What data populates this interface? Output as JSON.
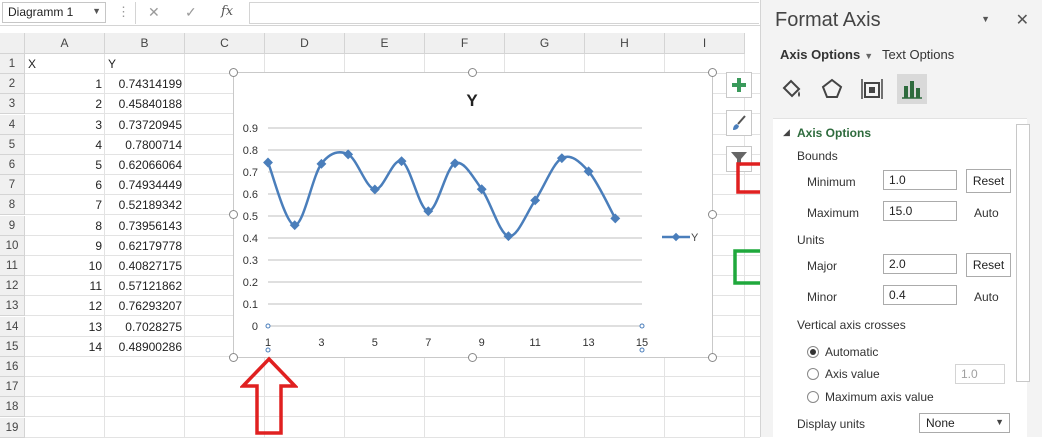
{
  "formula_bar": {
    "name_box": "Diagramm 1",
    "fx_label": "fx",
    "cancel_icon": "close-icon",
    "enter_icon": "check-icon"
  },
  "sheet": {
    "columns": [
      "A",
      "B",
      "C",
      "D",
      "E",
      "F",
      "G",
      "H",
      "I"
    ],
    "rows": [
      "1",
      "2",
      "3",
      "4",
      "5",
      "6",
      "7",
      "8",
      "9",
      "10",
      "11",
      "12",
      "13",
      "14",
      "15",
      "16",
      "17",
      "18",
      "19"
    ],
    "header_a": "X",
    "header_b": "Y",
    "data_x": [
      "1",
      "2",
      "3",
      "4",
      "5",
      "6",
      "7",
      "8",
      "9",
      "10",
      "11",
      "12",
      "13",
      "14"
    ],
    "data_y": [
      "0.74314199",
      "0.45840188",
      "0.73720945",
      "0.7800714",
      "0.62066064",
      "0.74934449",
      "0.52189342",
      "0.73956143",
      "0.62179778",
      "0.40827175",
      "0.57121862",
      "0.76293207",
      "0.7028275",
      "0.48900286"
    ]
  },
  "chart_data": {
    "type": "scatter",
    "title": "Y",
    "series": [
      {
        "name": "Y",
        "x": [
          1,
          2,
          3,
          4,
          5,
          6,
          7,
          8,
          9,
          10,
          11,
          12,
          13,
          14
        ],
        "values": [
          0.74314199,
          0.45840188,
          0.73720945,
          0.7800714,
          0.62066064,
          0.74934449,
          0.52189342,
          0.73956143,
          0.62179778,
          0.40827175,
          0.57121862,
          0.76293207,
          0.7028275,
          0.48900286
        ]
      }
    ],
    "xlim": [
      1,
      15
    ],
    "ylim": [
      0,
      0.9
    ],
    "x_ticks": [
      "1",
      "3",
      "5",
      "7",
      "9",
      "11",
      "13",
      "15"
    ],
    "y_ticks": [
      "0",
      "0.1",
      "0.2",
      "0.3",
      "0.4",
      "0.5",
      "0.6",
      "0.7",
      "0.8",
      "0.9"
    ],
    "grid": "horizontal",
    "smoothed_line": true,
    "legend_position": "right",
    "line_color": "#4a7ebb"
  },
  "chart_buttons": {
    "add_elements_icon": "plus-icon",
    "styles_icon": "brush-icon",
    "filters_icon": "filter-icon"
  },
  "annotations": {
    "arrow_color_red": "#e02020",
    "arrow_color_green": "#1fa83c"
  },
  "pane": {
    "title": "Format Axis",
    "tab_axis_options": "Axis Options",
    "tab_text_options": "Text Options",
    "section_title": "Axis Options",
    "bounds_label": "Bounds",
    "minimum_label": "Minimum",
    "minimum_value": "1.0",
    "maximum_label": "Maximum",
    "maximum_value": "15.0",
    "units_label": "Units",
    "major_label": "Major",
    "major_value": "2.0",
    "minor_label": "Minor",
    "minor_value": "0.4",
    "reset_label": "Reset",
    "auto_label": "Auto",
    "vertical_axis_crosses_label": "Vertical axis crosses",
    "radio_automatic": "Automatic",
    "radio_axis_value": "Axis value",
    "axis_value_input": "1.0",
    "radio_max_axis_value": "Maximum axis value",
    "display_units_label": "Display units",
    "display_units_value": "None"
  }
}
